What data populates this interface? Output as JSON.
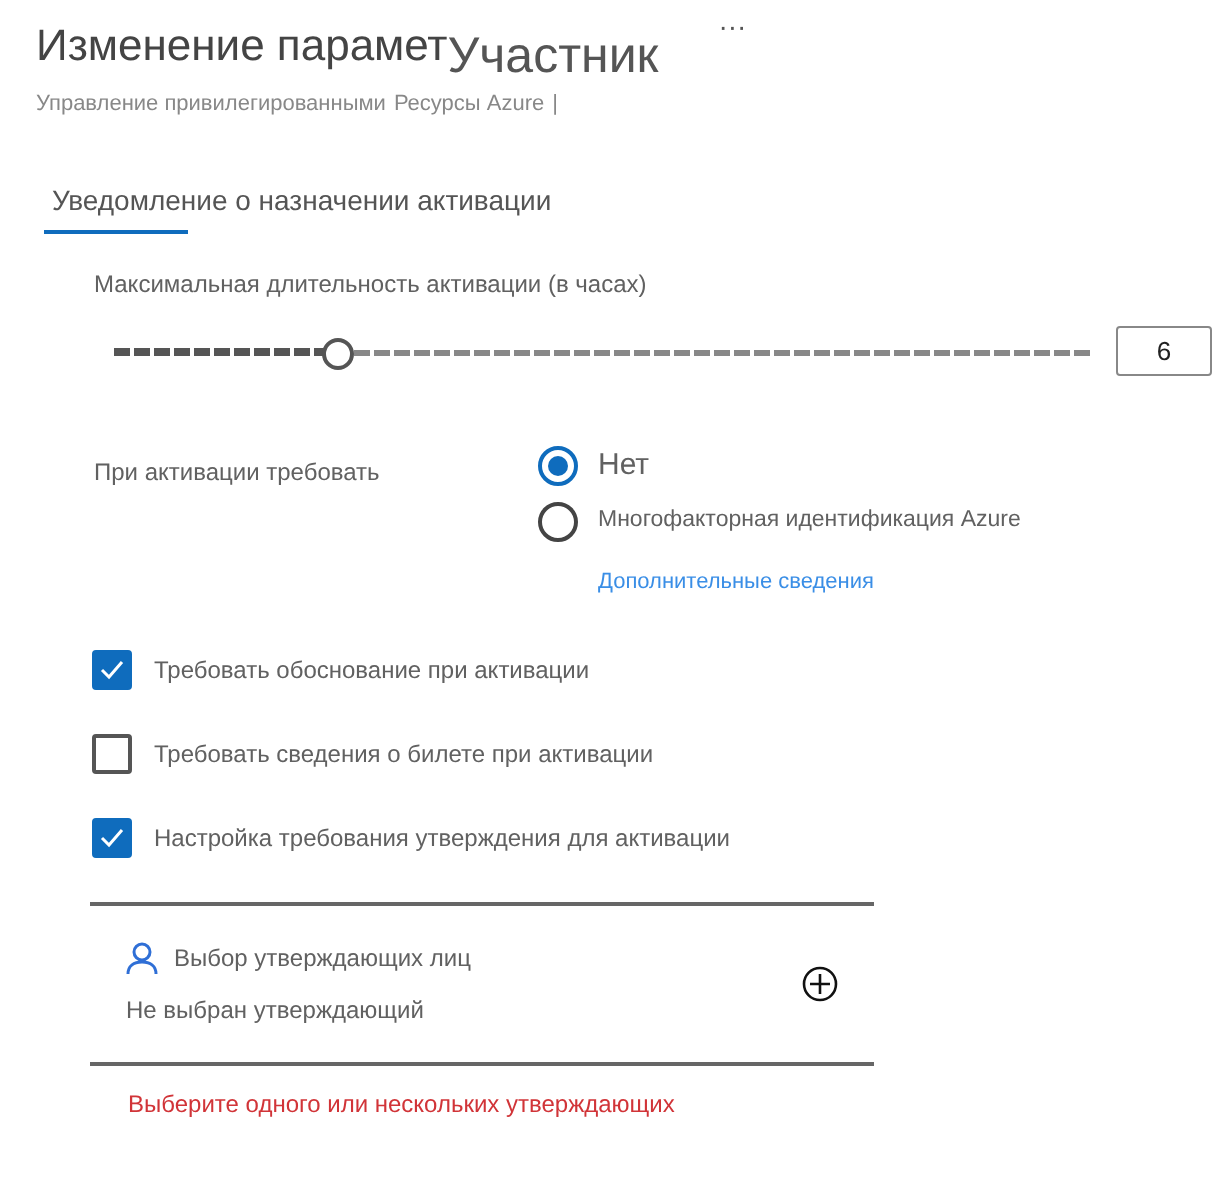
{
  "header": {
    "title": "Изменение парамет",
    "role": "Участник",
    "more": "···",
    "breadcrumb": "Управление привилегированными",
    "resource": "Ресурсы Azure",
    "separator": "|"
  },
  "tabs": [
    {
      "label": "Уведомление о назначении активации",
      "selected": true
    }
  ],
  "duration": {
    "label": "Максимальная длительность активации (в часах)",
    "level": 0.23,
    "value": "6"
  },
  "require": {
    "label": "При активации требовать",
    "options": [
      {
        "label": "Нет",
        "selected": true
      },
      {
        "label": "Многофакторная идентификация Azure",
        "selected": false
      }
    ],
    "link": "Дополнительные сведения"
  },
  "checks": [
    {
      "label": "Требовать обоснование при активации",
      "checked": true
    },
    {
      "label": "Требовать сведения о билете при активации",
      "checked": false
    },
    {
      "label": "Настройка требования утверждения для активации",
      "checked": true
    }
  ],
  "approvers": {
    "title": "Выбор утверждающих лиц",
    "value": "Не выбран утверждающий",
    "error": "Выберите одного или нескольких утверждающих"
  }
}
